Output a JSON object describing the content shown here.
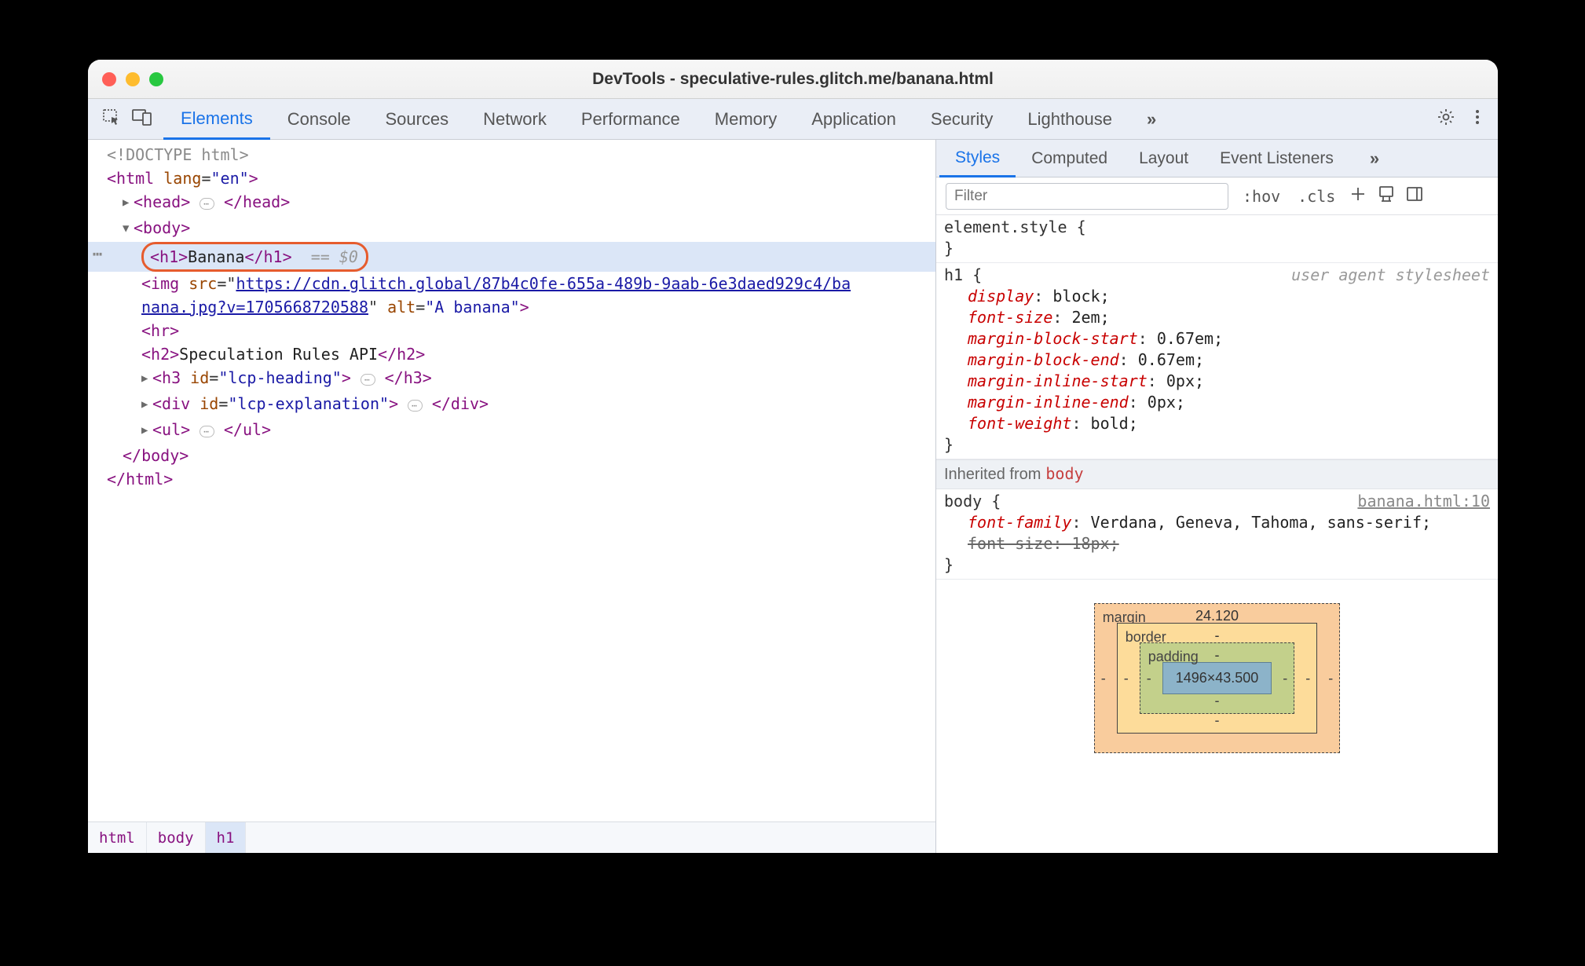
{
  "titlebar": {
    "title": "DevTools - speculative-rules.glitch.me/banana.html"
  },
  "tabs": {
    "items": [
      "Elements",
      "Console",
      "Sources",
      "Network",
      "Performance",
      "Memory",
      "Application",
      "Security",
      "Lighthouse"
    ],
    "active_index": 0
  },
  "dom": {
    "doctype": "<!DOCTYPE html>",
    "html_open": "<html lang=\"en\">",
    "head_collapsed": "<head> ⋯ </head>",
    "body_open": "<body>",
    "selected_node": "<h1>Banana</h1>",
    "selected_suffix": "== $0",
    "img_line1_pre": "<img src=\"",
    "img_url1": "https://cdn.glitch.global/87b4c0fe-655a-489b-9aab-6e3daed929c4/ba",
    "img_url2": "nana.jpg?v=1705668720588",
    "img_line2_post": "\" alt=\"A banana\">",
    "hr": "<hr>",
    "h2": "<h2>Speculation Rules API</h2>",
    "h3": "<h3 id=\"lcp-heading\"> ⋯ </h3>",
    "div": "<div id=\"lcp-explanation\"> ⋯ </div>",
    "ul": "<ul> ⋯ </ul>",
    "body_close": "</body>",
    "html_close": "</html>"
  },
  "crumbs": [
    "html",
    "body",
    "h1"
  ],
  "subtabs": {
    "items": [
      "Styles",
      "Computed",
      "Layout",
      "Event Listeners"
    ],
    "active_index": 0
  },
  "styles_toolbar": {
    "filter_placeholder": "Filter",
    "hov": ":hov",
    "cls": ".cls"
  },
  "styles": {
    "element_style": {
      "selector": "element.style",
      "decls": []
    },
    "h1_rule": {
      "selector": "h1",
      "source": "user agent stylesheet",
      "decls": [
        {
          "name": "display",
          "value": "block;"
        },
        {
          "name": "font-size",
          "value": "2em;"
        },
        {
          "name": "margin-block-start",
          "value": "0.67em;"
        },
        {
          "name": "margin-block-end",
          "value": "0.67em;"
        },
        {
          "name": "margin-inline-start",
          "value": "0px;"
        },
        {
          "name": "margin-inline-end",
          "value": "0px;"
        },
        {
          "name": "font-weight",
          "value": "bold;"
        }
      ]
    },
    "inherited_label": "Inherited from",
    "inherited_from": "body",
    "body_rule": {
      "selector": "body",
      "source": "banana.html:10",
      "decls": [
        {
          "name": "font-family",
          "value": "Verdana, Geneva, Tahoma, sans-serif;",
          "strike": false
        },
        {
          "name": "font-size",
          "value": "18px;",
          "strike": true
        }
      ]
    }
  },
  "box_model": {
    "margin_label": "margin",
    "margin_top": "24.120",
    "border_label": "border",
    "border_top": "-",
    "padding_label": "padding",
    "padding_top": "-",
    "content": "1496×43.500",
    "dash": "-"
  }
}
